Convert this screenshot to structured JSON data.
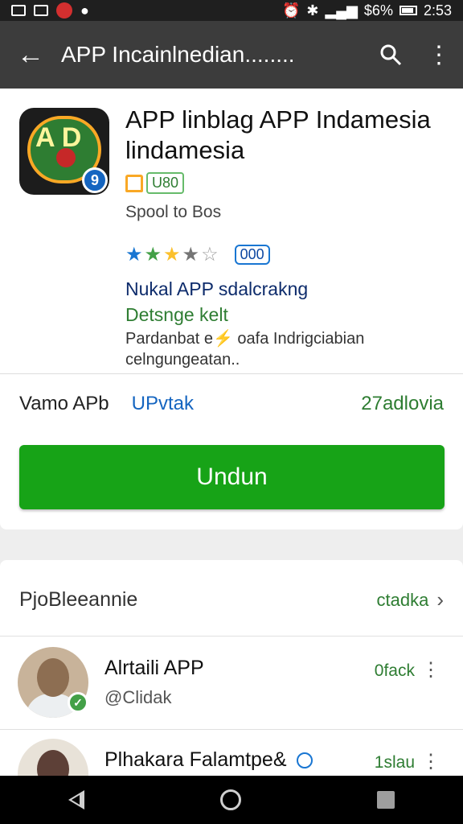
{
  "status_bar": {
    "battery": "$6%",
    "time": "2:53"
  },
  "toolbar": {
    "title": "APP Incainlnedian........"
  },
  "app": {
    "title": "APP linblag APP Indamesia lindamesia",
    "badge": "U80",
    "publisher": "Spool to Bos",
    "rating_count": "000",
    "rating_value": 3.5,
    "info_line_blue": "Nukal APP sdalcrakng",
    "info_line_green": "Detsnge kelt",
    "description": "Pardanbat e⚡ oafa Indrigciabian celngungeatan..",
    "meta_1": "Vamo APb",
    "meta_2": "UPvtak",
    "meta_3": "27adlovia",
    "install_label": "Undun"
  },
  "section": {
    "title": "PjoBleeannie",
    "more_label": "ctadka",
    "items": [
      {
        "name": "Alrtaili APP",
        "handle": "@Clidak",
        "stat": "0fack"
      },
      {
        "name": "Plhakara Falamtpe&",
        "handle": "",
        "stat": "1slau"
      }
    ]
  },
  "icons": [
    "back-arrow-icon",
    "search-icon",
    "overflow-menu-icon",
    "chevron-right-icon",
    "verified-icon",
    "nav-back-icon",
    "nav-home-icon",
    "nav-recents-icon"
  ]
}
